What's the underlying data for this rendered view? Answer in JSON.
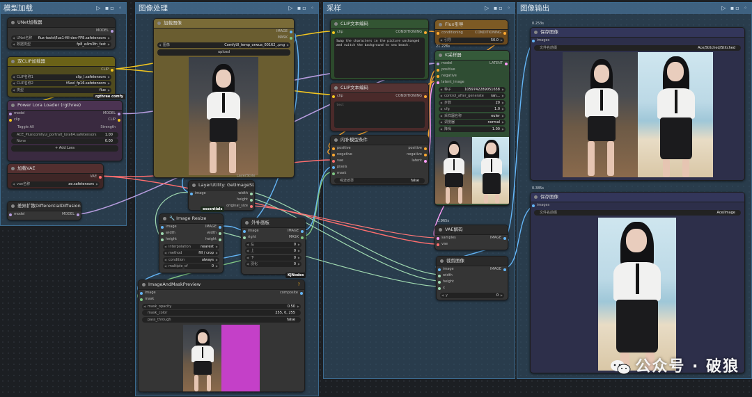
{
  "groups": {
    "model": "模型加载",
    "image": "图像处理",
    "sampling": "采样",
    "output": "图像输出"
  },
  "unet": {
    "title": "UNet加载器",
    "out": "MODEL",
    "w1_label": "UNet名称",
    "w1_value": "flux-tools\\flux1-fill-dev-FP8.safetensors",
    "w2_label": "数据类型",
    "w2_value": "fp8_e4m3fn_fast"
  },
  "dualclip": {
    "title": "双CLIP加载器",
    "out": "CLIP",
    "w1_label": "CLIP名称1",
    "w1_value": "clip_l.safetensors",
    "w2_label": "CLIP名称2",
    "w2_value": "t5xxl_fp16.safetensors",
    "w3_label": "类型",
    "w3_value": "flux",
    "badge": "rgthree comfy"
  },
  "lora": {
    "title": "Power Lora Loader (rgthree)",
    "in1": "model",
    "in2": "clip",
    "out1": "MODEL",
    "out2": "CLIP",
    "toggle": "Toggle All",
    "strength": "Strength",
    "l1_name": "ACE_Plus\\comfyui_portrait_lora64.safetensors",
    "l1_val": "1.00",
    "l2_name": "None",
    "l2_val": "0.00",
    "add": "+ Add Lora"
  },
  "vae": {
    "title": "加载VAE",
    "out": "VAE",
    "w_label": "vae名称",
    "w_value": "ae.safetensors"
  },
  "diff": {
    "title": "差异扩散DifferentialDiffusion",
    "in": "model",
    "out": "MODEL"
  },
  "loadimg": {
    "title": "加载图像",
    "out1": "IMAGE",
    "out2": "MASK",
    "w_label": "图像",
    "w_value": "ComfyUI_temp_orwua_00162_.png",
    "upload": "upload",
    "tag": "LayerStyle"
  },
  "getsize": {
    "title": "LayerUtility: GetImageSize",
    "in": "image",
    "out1": "width",
    "out2": "height",
    "out3": "original_size",
    "badge": "essentials"
  },
  "resize": {
    "title": "Image Resize",
    "in1": "image",
    "in2": "width",
    "in3": "height",
    "out1": "IMAGE",
    "out2": "width",
    "out3": "height",
    "w1_label": "interpolation",
    "w1_value": "nearest",
    "w2_label": "method",
    "w2_value": "fill / crop",
    "w3_label": "condition",
    "w3_value": "always",
    "w4_label": "multiple_of",
    "w4_value": "0"
  },
  "pad": {
    "title": "外补画板",
    "in1": "image",
    "in2": "right",
    "out1": "IMAGE",
    "out2": "MASK",
    "w1_label": "左",
    "w1_value": "0",
    "w2_label": "上",
    "w2_value": "0",
    "w3_label": "下",
    "w3_value": "0",
    "w4_label": "羽化",
    "w4_value": "0",
    "badge": "KJNodes"
  },
  "preview": {
    "title": "ImageAndMaskPreview",
    "in1": "image",
    "in2": "mask",
    "out": "composite",
    "w1_label": "mask_opacity",
    "w1_value": "0.50",
    "w2_label": "mask_color",
    "w2_value": "255, 0, 255",
    "w3_label": "pass_through",
    "w3_value": "false",
    "q": "?"
  },
  "clip1": {
    "title": "CLIP文本编码",
    "in": "clip",
    "out": "CONDITIONING",
    "text": "Swap the characters in the picture unchanged and switch the background to sea beach."
  },
  "clip2": {
    "title": "CLIP文本编码",
    "in": "clip",
    "out": "CONDITIONING",
    "text": "text"
  },
  "guide": {
    "title": "Flux引导",
    "in": "conditioning",
    "out": "CONDITIONING",
    "w_label": "引导",
    "w_value": "50.0",
    "timing": "21.226s"
  },
  "ksampler": {
    "title": "K采样器",
    "in1": "model",
    "in2": "positive",
    "in3": "negative",
    "in4": "latent_image",
    "out": "LATENT",
    "w1_label": "种子",
    "w1_value": "1059742289051658",
    "w2_label": "control_after_generate",
    "w2_value": "ran...",
    "w3_label": "步数",
    "w3_value": "20",
    "w4_label": "cfg",
    "w4_value": "1.0",
    "w5_label": "采样器名称",
    "w5_value": "euler",
    "w6_label": "调度器",
    "w6_value": "normal",
    "w7_label": "降噪",
    "w7_value": "1.00"
  },
  "inpaint": {
    "title": "内补模型条件",
    "in1": "positive",
    "in2": "negative",
    "in3": "vae",
    "in4": "pixels",
    "in5": "mask",
    "out1": "positive",
    "out2": "negative",
    "out3": "latent",
    "w_label": "噪波遮罩",
    "w_value": "false"
  },
  "vaedec": {
    "title": "VAE解码",
    "in1": "samples",
    "in2": "vae",
    "out": "IMAGE",
    "timing": "0.965s"
  },
  "crop": {
    "title": "裁剪图像",
    "in1": "image",
    "in2": "width",
    "in3": "height",
    "in4": "x",
    "out": "IMAGE",
    "w_label": "y",
    "w_value": "0"
  },
  "save1": {
    "title": "保存图像",
    "in": "images",
    "w_label": "文件名前缀",
    "w_value": "Ace/Stitched/Stitched",
    "timing": "0.253s"
  },
  "save2": {
    "title": "保存图像",
    "in": "images",
    "w_label": "文件名前缀",
    "w_value": "Ace/Image",
    "timing": "0.385s"
  },
  "watermark": "公众号 · 破狼",
  "colors": {
    "clip": "#f3c61f",
    "model": "#b69cde",
    "vae": "#ff6e6e",
    "image": "#64b5f6",
    "mask": "#81c784",
    "latent": "#ff9cf9",
    "cond": "#ffa931"
  }
}
